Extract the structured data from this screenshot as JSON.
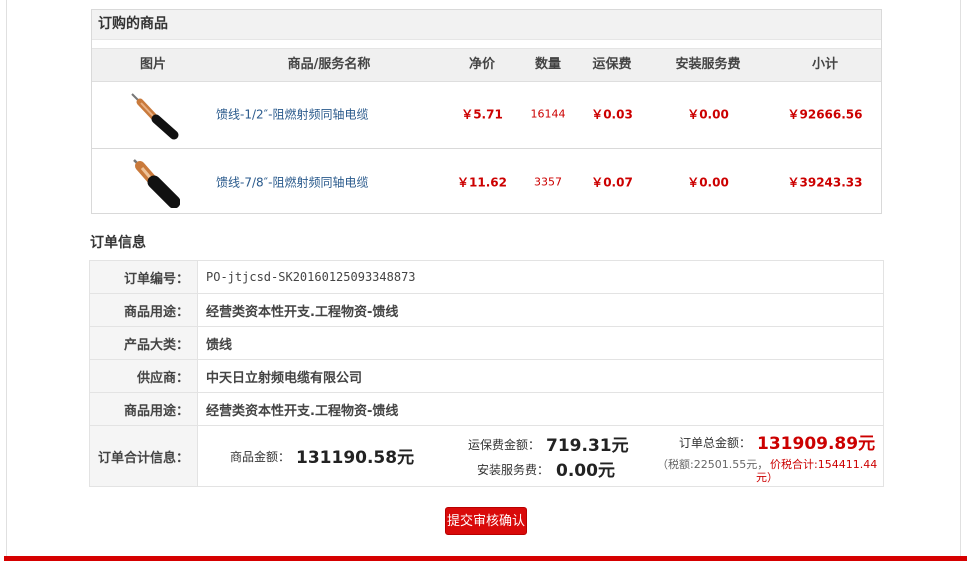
{
  "products": {
    "title": "订购的商品",
    "headers": {
      "image": "图片",
      "name": "商品/服务名称",
      "price": "净价",
      "qty": "数量",
      "shipping": "运保费",
      "install": "安装服务费",
      "subtotal": "小计"
    },
    "rows": [
      {
        "name": "馈线-1/2″-阻燃射频同轴电缆",
        "price": "￥5.71",
        "qty": "16144",
        "shipping": "￥0.03",
        "install": "￥0.00",
        "subtotal": "￥92666.56",
        "thumb_icon": "coax-cable-icon"
      },
      {
        "name": "馈线-7/8″-阻燃射频同轴电缆",
        "price": "￥11.62",
        "qty": "3357",
        "shipping": "￥0.07",
        "install": "￥0.00",
        "subtotal": "￥39243.33",
        "thumb_icon": "coax-cable-icon"
      }
    ]
  },
  "order": {
    "heading": "订单信息",
    "fields": [
      {
        "label": "订单编号：",
        "value": "PO-jtjcsd-SK20160125093348873"
      },
      {
        "label": "商品用途：",
        "value": "经营类资本性开支.工程物资-馈线"
      },
      {
        "label": "产品大类：",
        "value": "馈线"
      },
      {
        "label": "供应商：",
        "value": "中天日立射频电缆有限公司"
      },
      {
        "label": "商品用途：",
        "value": "经营类资本性开支.工程物资-馈线"
      }
    ],
    "summary": {
      "label": "订单合计信息：",
      "goods_label": "商品金额：",
      "goods_value": "131190.58元",
      "shipping_label": "运保费金额：",
      "shipping_value": "719.31元",
      "install_label": "安装服务费：",
      "install_value": "0.00元",
      "total_label": "订单总金额：",
      "total_value": "131909.89元",
      "tax_text": "（税额:22501.55元，",
      "tax_total_text": "价税合计:154411.44",
      "tax_total_unit": "元）"
    }
  },
  "actions": {
    "submit_label": "提交审核确认"
  },
  "colors": {
    "accent": "#d90a0a",
    "price": "#cc0000",
    "link": "#2a5a8c"
  }
}
